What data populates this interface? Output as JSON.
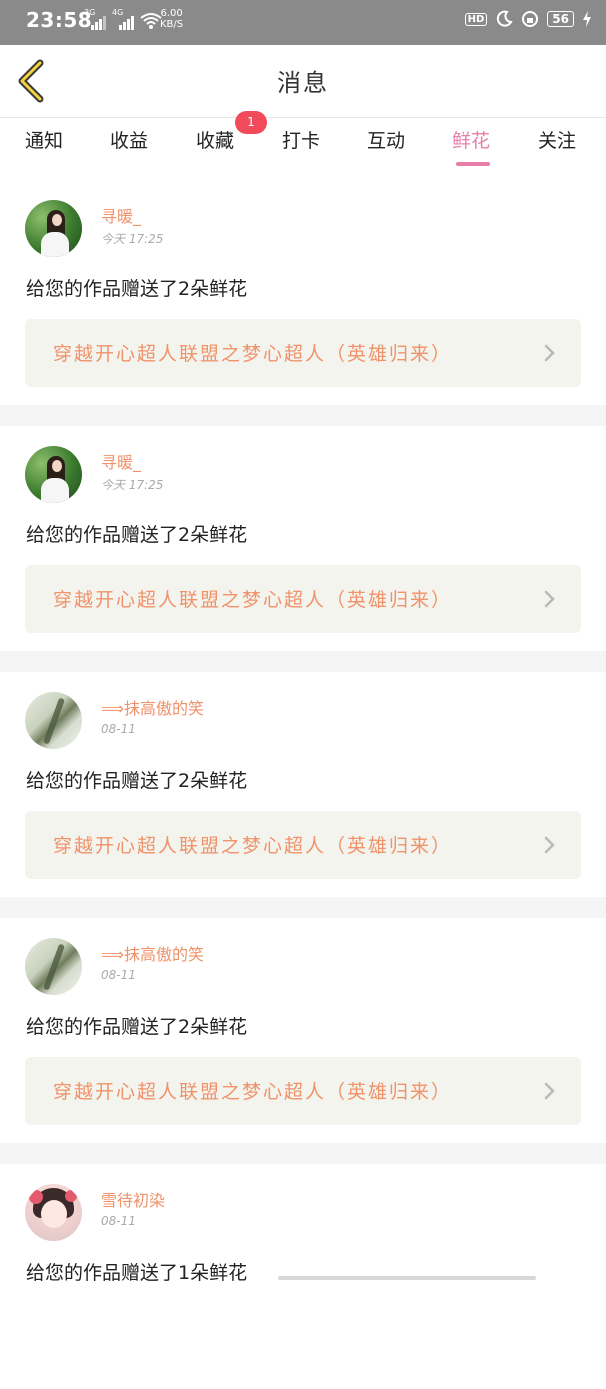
{
  "status_bar": {
    "time": "23:58",
    "net1": "3G",
    "net2": "4G",
    "speed_value": "6.00",
    "speed_unit": "KB/S",
    "hd": "HD",
    "battery": "56"
  },
  "header": {
    "title": "消息"
  },
  "tabs": [
    {
      "label": "通知"
    },
    {
      "label": "收益"
    },
    {
      "label": "收藏"
    },
    {
      "label": "打卡"
    },
    {
      "label": "互动"
    },
    {
      "label": "鲜花"
    },
    {
      "label": "关注"
    }
  ],
  "active_tab": "鲜花",
  "favorites_badge": "1",
  "colors": {
    "accent_pink": "#e87fa8",
    "name_orange": "#f0926a",
    "badge_red": "#f04a5b"
  },
  "feed": [
    {
      "user": "寻暖_",
      "time": "今天 17:25",
      "message": "给您的作品赠送了2朵鲜花",
      "work": "穿越开心超人联盟之梦心超人（英雄归来）",
      "avatar": "girl-in-forest"
    },
    {
      "user": "寻暖_",
      "time": "今天 17:25",
      "message": "给您的作品赠送了2朵鲜花",
      "work": "穿越开心超人联盟之梦心超人（英雄归来）",
      "avatar": "girl-in-forest"
    },
    {
      "user": "⟹抹高傲的笑",
      "time": "08-11",
      "message": "给您的作品赠送了2朵鲜花",
      "work": "穿越开心超人联盟之梦心超人（英雄归来）",
      "avatar": "leaf-drawing"
    },
    {
      "user": "⟹抹高傲的笑",
      "time": "08-11",
      "message": "给您的作品赠送了2朵鲜花",
      "work": "穿越开心超人联盟之梦心超人（英雄归来）",
      "avatar": "leaf-drawing"
    },
    {
      "user": "雪待初染",
      "time": "08-11",
      "message": "给您的作品赠送了1朵鲜花",
      "work": "",
      "avatar": "anime-girl"
    }
  ]
}
